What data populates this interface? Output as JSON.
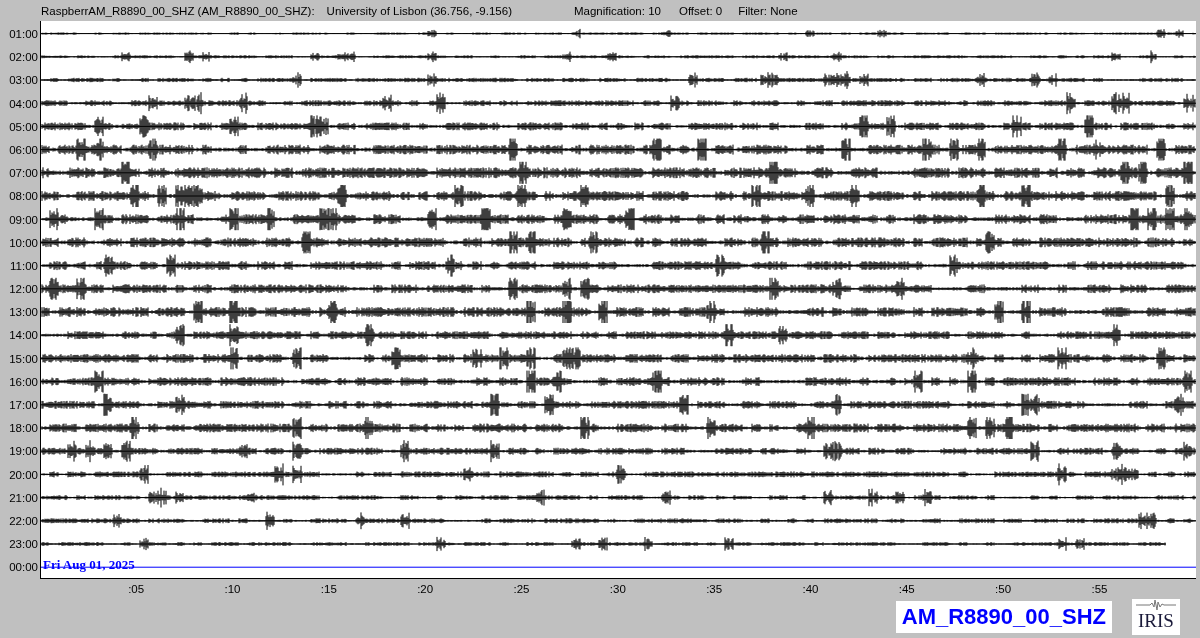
{
  "header": {
    "station": "RaspberrAM_R8890_00_SHZ (AM_R8890_00_SHZ):",
    "location": "University of Lisbon (36.756, -9.156)",
    "magnification": "Magnification: 10",
    "offset": "Offset: 0",
    "filter": "Filter: None"
  },
  "rows": [
    {
      "time": "01:00",
      "kind": "trace"
    },
    {
      "time": "02:00",
      "kind": "trace"
    },
    {
      "time": "03:00",
      "kind": "trace"
    },
    {
      "time": "04:00",
      "kind": "trace"
    },
    {
      "time": "05:00",
      "kind": "trace"
    },
    {
      "time": "06:00",
      "kind": "trace"
    },
    {
      "time": "07:00",
      "kind": "trace"
    },
    {
      "time": "08:00",
      "kind": "trace"
    },
    {
      "time": "09:00",
      "kind": "trace"
    },
    {
      "time": "10:00",
      "kind": "trace"
    },
    {
      "time": "11:00",
      "kind": "trace"
    },
    {
      "time": "12:00",
      "kind": "trace"
    },
    {
      "time": "13:00",
      "kind": "trace"
    },
    {
      "time": "14:00",
      "kind": "trace"
    },
    {
      "time": "15:00",
      "kind": "trace"
    },
    {
      "time": "16:00",
      "kind": "trace"
    },
    {
      "time": "17:00",
      "kind": "trace"
    },
    {
      "time": "18:00",
      "kind": "trace"
    },
    {
      "time": "19:00",
      "kind": "trace"
    },
    {
      "time": "20:00",
      "kind": "trace"
    },
    {
      "time": "21:00",
      "kind": "trace"
    },
    {
      "time": "22:00",
      "kind": "trace"
    },
    {
      "time": "23:00",
      "kind": "trace"
    },
    {
      "time": "00:00",
      "kind": "current",
      "date": "Fri Aug 01, 2025"
    }
  ],
  "x_ticks": [
    ":05",
    ":10",
    ":15",
    ":20",
    ":25",
    ":30",
    ":35",
    ":40",
    ":45",
    ":50",
    ":55"
  ],
  "station_label": "AM_R8890_00_SHZ",
  "logo_text": "IRIS"
}
